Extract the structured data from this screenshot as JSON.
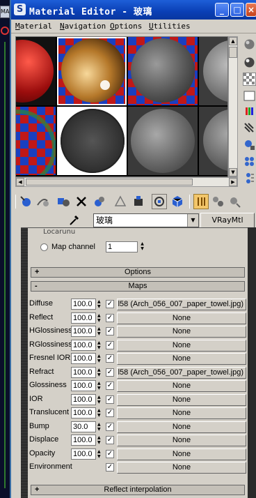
{
  "background": {
    "tab_text": "MA"
  },
  "window": {
    "title": "Material Editor - 玻璃",
    "app_icon": "3ds-max-logo-icon",
    "controls": {
      "minimize": "_",
      "maximize": "□",
      "close": "×"
    }
  },
  "menubar": [
    {
      "label": "Material",
      "u": "M"
    },
    {
      "label": "Navigation",
      "u": "N"
    },
    {
      "label": "Options",
      "u": "O"
    },
    {
      "label": "Utilities",
      "u": "U"
    }
  ],
  "material": {
    "name": "玻璃",
    "type": "VRayMtl"
  },
  "mapping": {
    "fragment": "Locarunu",
    "map_channel_label": "Map channel",
    "map_channel_value": "1"
  },
  "rollouts": {
    "options": {
      "sign": "+",
      "title": "Options"
    },
    "maps": {
      "sign": "-",
      "title": "Maps"
    },
    "reflect_interp": {
      "sign": "+",
      "title": "Reflect interpolation"
    }
  },
  "maps": [
    {
      "label": "Diffuse",
      "amount": "100.0",
      "checked": true,
      "map": "l58 (Arch_056_007_paper_towel.jpg)"
    },
    {
      "label": "Reflect",
      "amount": "100.0",
      "checked": true,
      "map": "None"
    },
    {
      "label": "HGlossiness",
      "amount": "100.0",
      "checked": true,
      "map": "None"
    },
    {
      "label": "RGlossiness",
      "amount": "100.0",
      "checked": true,
      "map": "None"
    },
    {
      "label": "Fresnel IOR",
      "amount": "100.0",
      "checked": true,
      "map": "None"
    },
    {
      "label": "Refract",
      "amount": "100.0",
      "checked": true,
      "map": "l58 (Arch_056_007_paper_towel.jpg)"
    },
    {
      "label": "Glossiness",
      "amount": "100.0",
      "checked": true,
      "map": "None"
    },
    {
      "label": "IOR",
      "amount": "100.0",
      "checked": true,
      "map": "None"
    },
    {
      "label": "Translucent",
      "amount": "100.0",
      "checked": true,
      "map": "None"
    },
    {
      "label": "Bump",
      "amount": "30.0",
      "checked": true,
      "map": "None"
    },
    {
      "label": "Displace",
      "amount": "100.0",
      "checked": true,
      "map": "None"
    },
    {
      "label": "Opacity",
      "amount": "100.0",
      "checked": true,
      "map": "None"
    },
    {
      "label": "Environment",
      "amount": "",
      "checked": true,
      "map": "None"
    }
  ],
  "colors": {
    "title_bar": "#0a3fb5",
    "window_face": "#d4d0c8",
    "selected_tool": "#f3c66a"
  }
}
